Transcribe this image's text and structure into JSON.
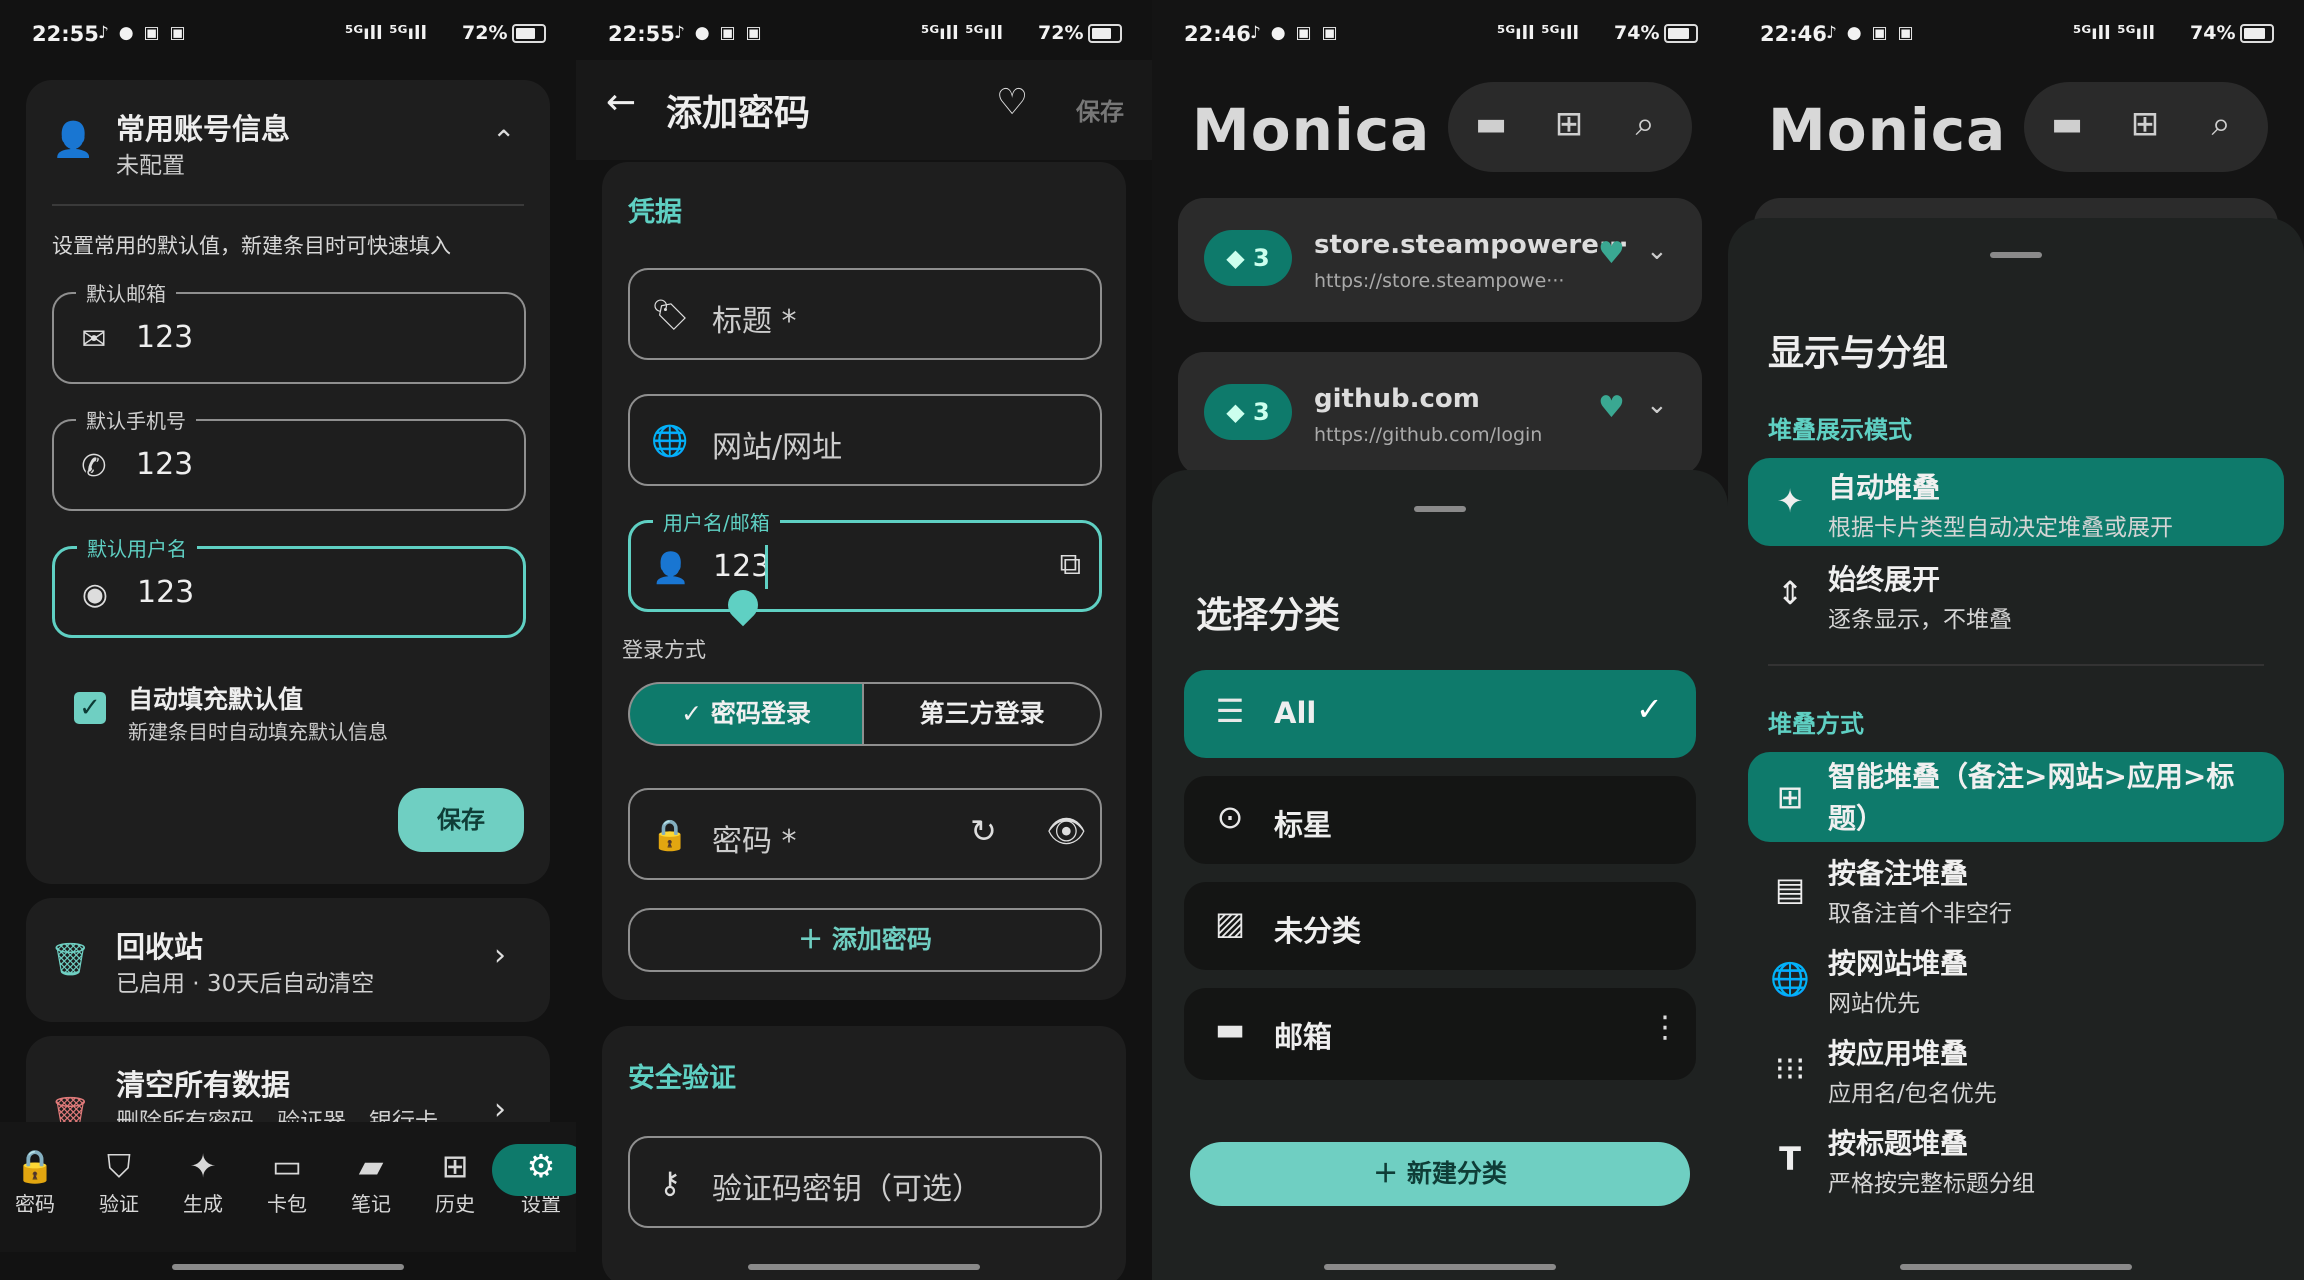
{
  "status": [
    {
      "time": "22:55",
      "signal": "⁵ᴳıll ⁵ᴳıll",
      "battery": "72%"
    },
    {
      "time": "22:55",
      "signal": "⁵ᴳıll ⁵ᴳıll",
      "battery": "72%"
    },
    {
      "time": "22:46",
      "signal": "⁵ᴳıll ⁵ᴳıll",
      "battery": "74%"
    },
    {
      "time": "22:46",
      "signal": "⁵ᴳıll ⁵ᴳıll",
      "battery": "74%"
    }
  ],
  "defaults_card": {
    "title": "常用账号信息",
    "subtitle": "未配置",
    "description": "设置常用的默认值，新建条目时可快速填入",
    "email_label": "默认邮箱",
    "email_value": "123",
    "phone_label": "默认手机号",
    "phone_value": "123",
    "username_label": "默认用户名",
    "username_value": "123",
    "autofill_title": "自动填充默认值",
    "autofill_subtitle": "新建条目时自动填充默认信息",
    "autofill_checked": true,
    "save_label": "保存"
  },
  "recycle": {
    "title": "回收站",
    "subtitle": "已启用 · 30天后自动清空"
  },
  "clear_all": {
    "title": "清空所有数据",
    "subtitle": "删除所有密码、验证器、银行卡"
  },
  "bottom_nav": [
    {
      "label": "密码",
      "icon": "lock-icon"
    },
    {
      "label": "验证",
      "icon": "shield-icon"
    },
    {
      "label": "生成",
      "icon": "sparkle-icon"
    },
    {
      "label": "卡包",
      "icon": "card-icon"
    },
    {
      "label": "笔记",
      "icon": "note-icon"
    },
    {
      "label": "历史",
      "icon": "history-icon"
    },
    {
      "label": "设置",
      "icon": "gear-icon",
      "active": true
    }
  ],
  "add_password": {
    "title": "添加密码",
    "save_label": "保存",
    "credentials_heading": "凭据",
    "title_field": "标题 *",
    "website_field": "网站/网址",
    "username_label": "用户名/邮箱",
    "username_value": "123",
    "login_method_label": "登录方式",
    "login_options": [
      "密码登录",
      "第三方登录"
    ],
    "login_selected": "密码登录",
    "password_field": "密码 *",
    "add_password_button": "添加密码",
    "security_heading": "安全验证",
    "otp_field": "验证码密钥（可选）"
  },
  "monica": {
    "brand": "Monica",
    "entries": [
      {
        "count": "3",
        "title": "store.steampowere···",
        "url": "https://store.steampowe···"
      },
      {
        "count": "3",
        "title": "github.com",
        "url": "https://github.com/login"
      }
    ],
    "category_sheet": {
      "title": "选择分类",
      "categories": [
        {
          "label": "All",
          "icon": "list-icon",
          "selected": true
        },
        {
          "label": "标星",
          "icon": "check-circle-icon"
        },
        {
          "label": "未分类",
          "icon": "folder-off-icon"
        },
        {
          "label": "邮箱",
          "icon": "folder-icon"
        }
      ],
      "new_category": "新建分类"
    }
  },
  "display_sheet": {
    "title": "显示与分组",
    "stack_mode_heading": "堆叠展示模式",
    "stack_modes": [
      {
        "title": "自动堆叠",
        "subtitle": "根据卡片类型自动决定堆叠或展开",
        "icon": "sparkle-icon",
        "selected": true
      },
      {
        "title": "始终展开",
        "subtitle": "逐条显示，不堆叠",
        "icon": "unfold-icon"
      }
    ],
    "stack_method_heading": "堆叠方式",
    "stack_methods": [
      {
        "title": "智能堆叠（备注>网站>应用>标题）",
        "icon": "dashboard-add-icon",
        "selected": true
      },
      {
        "title": "按备注堆叠",
        "subtitle": "取备注首个非空行",
        "icon": "document-icon"
      },
      {
        "title": "按网站堆叠",
        "subtitle": "网站优先",
        "icon": "globe-icon"
      },
      {
        "title": "按应用堆叠",
        "subtitle": "应用名/包名优先",
        "icon": "apps-icon"
      },
      {
        "title": "按标题堆叠",
        "subtitle": "严格按完整标题分组",
        "icon": "text-icon"
      }
    ]
  },
  "colors": {
    "accent": "#0e7a6b",
    "accent_light": "#6fcfc2",
    "teal_text": "#5fd0c3"
  }
}
